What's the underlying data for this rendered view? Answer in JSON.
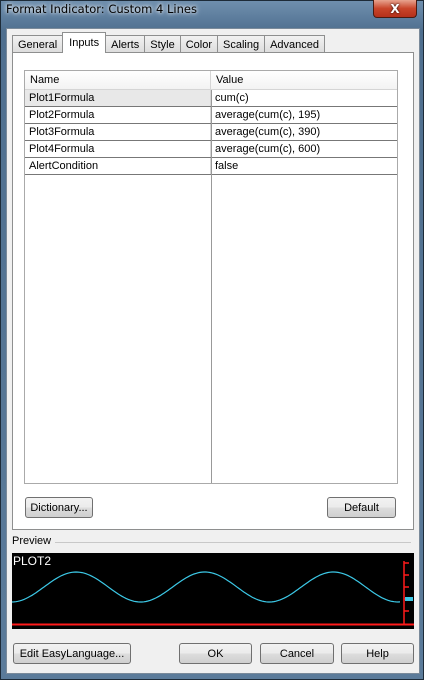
{
  "window": {
    "title": "Format Indicator: Custom 4 Lines",
    "close_label": "X"
  },
  "tabs": [
    {
      "label": "General"
    },
    {
      "label": "Inputs",
      "active": true
    },
    {
      "label": "Alerts"
    },
    {
      "label": "Style"
    },
    {
      "label": "Color"
    },
    {
      "label": "Scaling"
    },
    {
      "label": "Advanced"
    }
  ],
  "inputs_table": {
    "columns": {
      "name": "Name",
      "value": "Value"
    },
    "rows": [
      {
        "name": "Plot1Formula",
        "value": "cum(c)"
      },
      {
        "name": "Plot2Formula",
        "value": "average(cum(c), 195)"
      },
      {
        "name": "Plot3Formula",
        "value": "average(cum(c), 390)"
      },
      {
        "name": "Plot4Formula",
        "value": "average(cum(c), 600)"
      },
      {
        "name": "AlertCondition",
        "value": "false"
      }
    ]
  },
  "buttons": {
    "dictionary": "Dictionary...",
    "default": "Default",
    "edit_easylanguage": "Edit EasyLanguage...",
    "ok": "OK",
    "cancel": "Cancel",
    "help": "Help"
  },
  "preview": {
    "label": "Preview",
    "plot_name": "PLOT2",
    "line_color": "#3cc8e6",
    "axis_color": "#ff1a1a",
    "background": "#000000"
  }
}
